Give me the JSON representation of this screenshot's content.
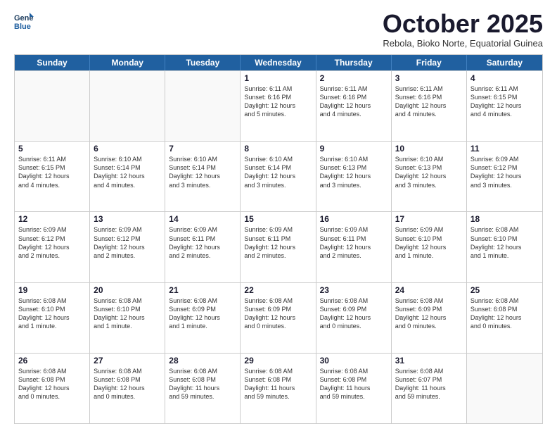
{
  "header": {
    "logo_line1": "General",
    "logo_line2": "Blue",
    "month": "October 2025",
    "location": "Rebola, Bioko Norte, Equatorial Guinea"
  },
  "weekdays": [
    "Sunday",
    "Monday",
    "Tuesday",
    "Wednesday",
    "Thursday",
    "Friday",
    "Saturday"
  ],
  "rows": [
    [
      {
        "day": "",
        "info": ""
      },
      {
        "day": "",
        "info": ""
      },
      {
        "day": "",
        "info": ""
      },
      {
        "day": "1",
        "info": "Sunrise: 6:11 AM\nSunset: 6:16 PM\nDaylight: 12 hours\nand 5 minutes."
      },
      {
        "day": "2",
        "info": "Sunrise: 6:11 AM\nSunset: 6:16 PM\nDaylight: 12 hours\nand 4 minutes."
      },
      {
        "day": "3",
        "info": "Sunrise: 6:11 AM\nSunset: 6:16 PM\nDaylight: 12 hours\nand 4 minutes."
      },
      {
        "day": "4",
        "info": "Sunrise: 6:11 AM\nSunset: 6:15 PM\nDaylight: 12 hours\nand 4 minutes."
      }
    ],
    [
      {
        "day": "5",
        "info": "Sunrise: 6:11 AM\nSunset: 6:15 PM\nDaylight: 12 hours\nand 4 minutes."
      },
      {
        "day": "6",
        "info": "Sunrise: 6:10 AM\nSunset: 6:14 PM\nDaylight: 12 hours\nand 4 minutes."
      },
      {
        "day": "7",
        "info": "Sunrise: 6:10 AM\nSunset: 6:14 PM\nDaylight: 12 hours\nand 3 minutes."
      },
      {
        "day": "8",
        "info": "Sunrise: 6:10 AM\nSunset: 6:14 PM\nDaylight: 12 hours\nand 3 minutes."
      },
      {
        "day": "9",
        "info": "Sunrise: 6:10 AM\nSunset: 6:13 PM\nDaylight: 12 hours\nand 3 minutes."
      },
      {
        "day": "10",
        "info": "Sunrise: 6:10 AM\nSunset: 6:13 PM\nDaylight: 12 hours\nand 3 minutes."
      },
      {
        "day": "11",
        "info": "Sunrise: 6:09 AM\nSunset: 6:12 PM\nDaylight: 12 hours\nand 3 minutes."
      }
    ],
    [
      {
        "day": "12",
        "info": "Sunrise: 6:09 AM\nSunset: 6:12 PM\nDaylight: 12 hours\nand 2 minutes."
      },
      {
        "day": "13",
        "info": "Sunrise: 6:09 AM\nSunset: 6:12 PM\nDaylight: 12 hours\nand 2 minutes."
      },
      {
        "day": "14",
        "info": "Sunrise: 6:09 AM\nSunset: 6:11 PM\nDaylight: 12 hours\nand 2 minutes."
      },
      {
        "day": "15",
        "info": "Sunrise: 6:09 AM\nSunset: 6:11 PM\nDaylight: 12 hours\nand 2 minutes."
      },
      {
        "day": "16",
        "info": "Sunrise: 6:09 AM\nSunset: 6:11 PM\nDaylight: 12 hours\nand 2 minutes."
      },
      {
        "day": "17",
        "info": "Sunrise: 6:09 AM\nSunset: 6:10 PM\nDaylight: 12 hours\nand 1 minute."
      },
      {
        "day": "18",
        "info": "Sunrise: 6:08 AM\nSunset: 6:10 PM\nDaylight: 12 hours\nand 1 minute."
      }
    ],
    [
      {
        "day": "19",
        "info": "Sunrise: 6:08 AM\nSunset: 6:10 PM\nDaylight: 12 hours\nand 1 minute."
      },
      {
        "day": "20",
        "info": "Sunrise: 6:08 AM\nSunset: 6:10 PM\nDaylight: 12 hours\nand 1 minute."
      },
      {
        "day": "21",
        "info": "Sunrise: 6:08 AM\nSunset: 6:09 PM\nDaylight: 12 hours\nand 1 minute."
      },
      {
        "day": "22",
        "info": "Sunrise: 6:08 AM\nSunset: 6:09 PM\nDaylight: 12 hours\nand 0 minutes."
      },
      {
        "day": "23",
        "info": "Sunrise: 6:08 AM\nSunset: 6:09 PM\nDaylight: 12 hours\nand 0 minutes."
      },
      {
        "day": "24",
        "info": "Sunrise: 6:08 AM\nSunset: 6:09 PM\nDaylight: 12 hours\nand 0 minutes."
      },
      {
        "day": "25",
        "info": "Sunrise: 6:08 AM\nSunset: 6:08 PM\nDaylight: 12 hours\nand 0 minutes."
      }
    ],
    [
      {
        "day": "26",
        "info": "Sunrise: 6:08 AM\nSunset: 6:08 PM\nDaylight: 12 hours\nand 0 minutes."
      },
      {
        "day": "27",
        "info": "Sunrise: 6:08 AM\nSunset: 6:08 PM\nDaylight: 12 hours\nand 0 minutes."
      },
      {
        "day": "28",
        "info": "Sunrise: 6:08 AM\nSunset: 6:08 PM\nDaylight: 11 hours\nand 59 minutes."
      },
      {
        "day": "29",
        "info": "Sunrise: 6:08 AM\nSunset: 6:08 PM\nDaylight: 11 hours\nand 59 minutes."
      },
      {
        "day": "30",
        "info": "Sunrise: 6:08 AM\nSunset: 6:08 PM\nDaylight: 11 hours\nand 59 minutes."
      },
      {
        "day": "31",
        "info": "Sunrise: 6:08 AM\nSunset: 6:07 PM\nDaylight: 11 hours\nand 59 minutes."
      },
      {
        "day": "",
        "info": ""
      }
    ]
  ]
}
